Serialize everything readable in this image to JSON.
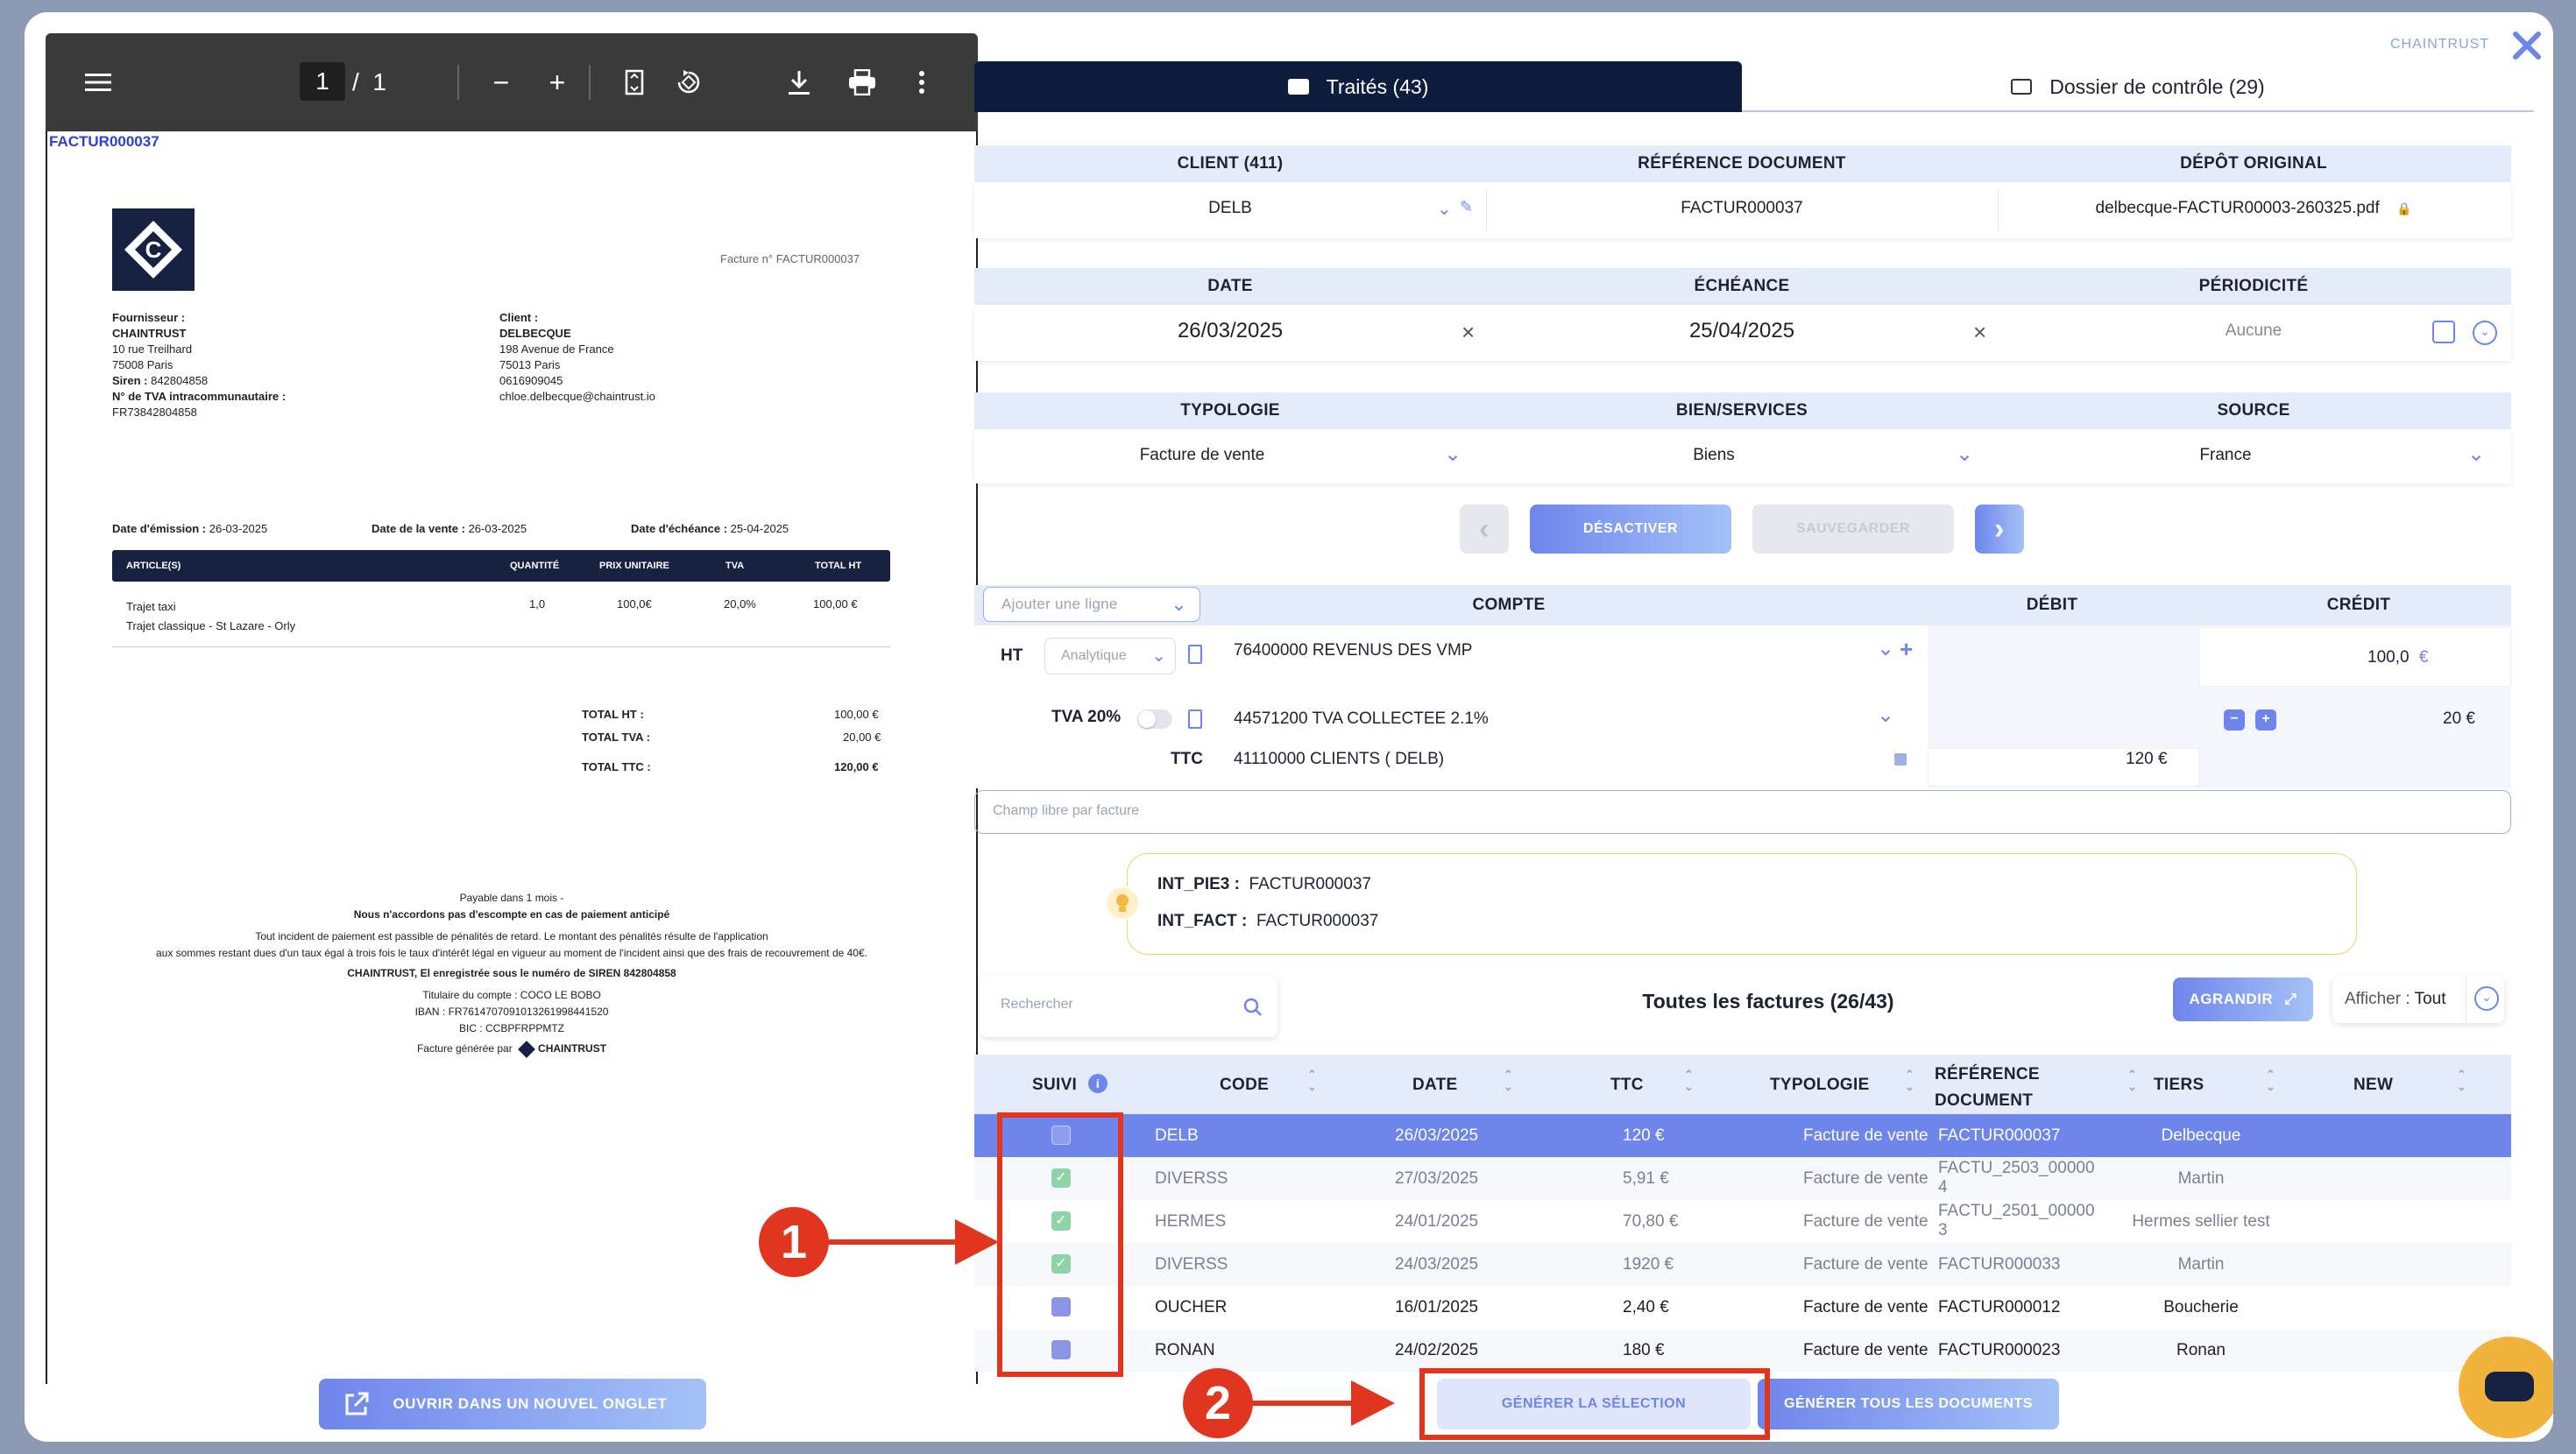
{
  "brand": "CHAINTRUST",
  "pdf": {
    "page_current": "1",
    "page_sep": "/",
    "page_total": "1",
    "doc_link": "FACTUR000037",
    "logo_letter": "C",
    "invoice_no": "Facture n° FACTUR000037",
    "supplier_label": "Fournisseur :",
    "supplier_name": "CHAINTRUST",
    "supplier_addr1": "10 rue Treilhard",
    "supplier_addr2": "75008 Paris",
    "supplier_siren_label": "Siren :",
    "supplier_siren": "842804858",
    "supplier_vat_label": "N° de TVA intracommunautaire :",
    "supplier_vat": "FR73842804858",
    "client_label": "Client :",
    "client_name": "DELBECQUE",
    "client_addr1": "198 Avenue de France",
    "client_addr2": "75013 Paris",
    "client_phone": "0616909045",
    "client_email": "chloe.delbecque@chaintrust.io",
    "issue_label": "Date d'émission :",
    "issue_date": "26-03-2025",
    "sale_label": "Date de la vente :",
    "sale_date": "26-03-2025",
    "due_label": "Date d'échéance :",
    "due_date": "25-04-2025",
    "cols": [
      "ARTICLE(S)",
      "QUANTITÉ",
      "PRIX UNITAIRE",
      "TVA",
      "TOTAL HT"
    ],
    "line_name": "Trajet taxi",
    "line_desc": "Trajet classique - St Lazare - Orly",
    "line_qty": "1,0",
    "line_price": "100,0€",
    "line_vat": "20,0%",
    "line_total": "100,00 €",
    "total_ht_label": "TOTAL HT :",
    "total_ht": "100,00 €",
    "total_tva_label": "TOTAL TVA :",
    "total_tva": "20,00 €",
    "total_ttc_label": "TOTAL TTC :",
    "total_ttc": "120,00 €",
    "footer1": "Payable dans 1 mois -",
    "footer2": "Nous n'accordons pas d'escompte en cas de paiement anticipé",
    "footer3": "Tout incident de paiement est passible de pénalités de retard. Le montant des pénalités résulte de l'application",
    "footer4": "aux sommes restant dues d'un taux égal à trois fois le taux d'intérêt légal en vigueur au moment de l'incident ainsi que des frais de recouvrement de 40€.",
    "footer5": "CHAINTRUST, El enregistrée sous le numéro de SIREN 842804858",
    "footer6": "Titulaire du compte : COCO LE BOBO",
    "footer7": "IBAN : FR7614707091013261998441520",
    "footer8": "BIC : CCBPFRPPMTZ",
    "footer9": "Facture générée par",
    "footer_brand": "CHAINTRUST"
  },
  "open_tab_button": "OUVRIR DANS UN NOUVEL ONGLET",
  "tabs": {
    "traites": "Traités (43)",
    "dossier": "Dossier de contrôle (29)"
  },
  "doc_info": {
    "client_h": "CLIENT (411)",
    "ref_h": "RÉFÉRENCE DOCUMENT",
    "depot_h": "DÉPÔT ORIGINAL",
    "client": "DELB",
    "ref": "FACTUR000037",
    "depot": "delbecque-FACTUR00003-260325.pdf",
    "date_h": "DATE",
    "echeance_h": "ÉCHÉANCE",
    "periodicite_h": "PÉRIODICITÉ",
    "date": "26/03/2025",
    "echeance": "25/04/2025",
    "periodicite": "Aucune",
    "typologie_h": "TYPOLOGIE",
    "bien_h": "BIEN/SERVICES",
    "source_h": "SOURCE",
    "typologie": "Facture de vente",
    "bien": "Biens",
    "source": "France"
  },
  "actions": {
    "prev": "‹",
    "desactiver": "DÉSACTIVER",
    "sauvegarder": "SAUVEGARDER",
    "next": "›"
  },
  "entries": {
    "add_line_placeholder": "Ajouter une ligne",
    "compte_h": "COMPTE",
    "debit_h": "DÉBIT",
    "credit_h": "CRÉDIT",
    "ht_label": "HT",
    "analytique": "Analytique",
    "ht_compte": "76400000 REVENUS DES VMP",
    "ht_credit": "100,0",
    "euro": "€",
    "tva_label": "TVA 20%",
    "tva_compte": "44571200 TVA COLLECTEE 2.1%",
    "tva_credit": "20 €",
    "ttc_label": "TTC",
    "ttc_compte": "41110000 CLIENTS ( DELB)",
    "ttc_debit": "120 €"
  },
  "free_field_placeholder": "Champ libre par facture",
  "tips": {
    "pie3_label": "INT_PIE3 :",
    "pie3": "FACTUR000037",
    "fact_label": "INT_FACT :",
    "fact": "FACTUR000037"
  },
  "list": {
    "search_placeholder": "Rechercher",
    "title": "Toutes les factures (26/43)",
    "agrandir": "AGRANDIR",
    "afficher_label": "Afficher :",
    "afficher_value": "Tout",
    "cols": {
      "suivi": "SUIVI",
      "code": "CODE",
      "date": "DATE",
      "ttc": "TTC",
      "typologie": "TYPOLOGIE",
      "ref1": "RÉFÉRENCE",
      "ref2": "DOCUMENT",
      "tiers": "TIERS",
      "new": "NEW"
    },
    "rows": [
      {
        "code": "DELB",
        "date": "26/03/2025",
        "ttc": "120 €",
        "typo": "Facture de vente",
        "ref": "FACTUR000037",
        "ref2": "",
        "tiers": "Delbecque"
      },
      {
        "code": "DIVERSS",
        "date": "27/03/2025",
        "ttc": "5,91 €",
        "typo": "Facture de vente",
        "ref": "FACTU_2503_00000",
        "ref2": "4",
        "tiers": "Martin"
      },
      {
        "code": "HERMES",
        "date": "24/01/2025",
        "ttc": "70,80 €",
        "typo": "Facture de vente",
        "ref": "FACTU_2501_00000",
        "ref2": "3",
        "tiers": "Hermes sellier test"
      },
      {
        "code": "DIVERSS",
        "date": "24/03/2025",
        "ttc": "1920 €",
        "typo": "Facture de vente",
        "ref": "FACTUR000033",
        "ref2": "",
        "tiers": "Martin"
      },
      {
        "code": "OUCHER",
        "date": "16/01/2025",
        "ttc": "2,40 €",
        "typo": "Facture de vente",
        "ref": "FACTUR000012",
        "ref2": "",
        "tiers": "Boucherie"
      },
      {
        "code": "RONAN",
        "date": "24/02/2025",
        "ttc": "180 €",
        "typo": "Facture de vente",
        "ref": "FACTUR000023",
        "ref2": "",
        "tiers": "Ronan"
      }
    ]
  },
  "bottom": {
    "generer_selection": "GÉNÉRER LA SÉLECTION",
    "generer_tous": "GÉNÉRER TOUS LES DOCUMENTS"
  },
  "annotations": {
    "one": "1",
    "two": "2"
  },
  "colors": {
    "primary": "#6e86ec",
    "navy": "#0e1c3e",
    "selected_row": "#6e86ec",
    "annotation": "#e0351f",
    "chat": "#f2b33d"
  }
}
